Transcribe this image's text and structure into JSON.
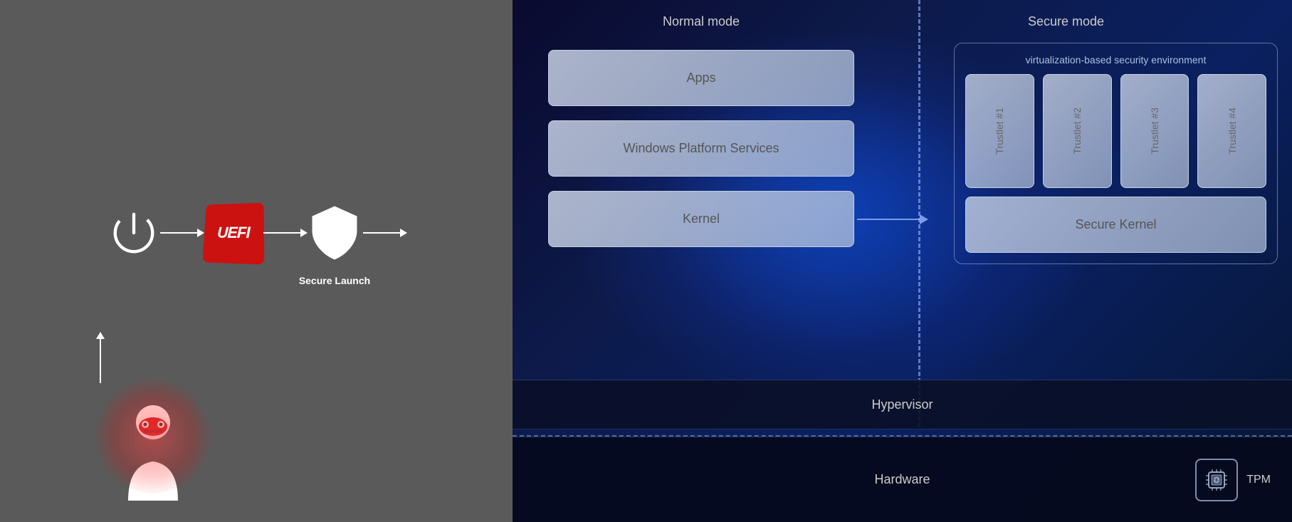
{
  "left": {
    "flow": {
      "power_label": "",
      "uefi_label": "UEFI",
      "secure_launch_label": "Secure Launch"
    }
  },
  "right": {
    "normal_mode_label": "Normal mode",
    "secure_mode_label": "Secure mode",
    "vbs_label": "virtualization-based security environment",
    "apps_label": "Apps",
    "wps_label": "Windows Platform Services",
    "kernel_label": "Kernel",
    "secure_kernel_label": "Secure Kernel",
    "hypervisor_label": "Hypervisor",
    "hardware_label": "Hardware",
    "tpm_label": "TPM",
    "trustlets": [
      {
        "label": "Trustlet #1"
      },
      {
        "label": "Trustlet #2"
      },
      {
        "label": "Trustlet #3"
      },
      {
        "label": "Trustlet #4"
      }
    ]
  }
}
